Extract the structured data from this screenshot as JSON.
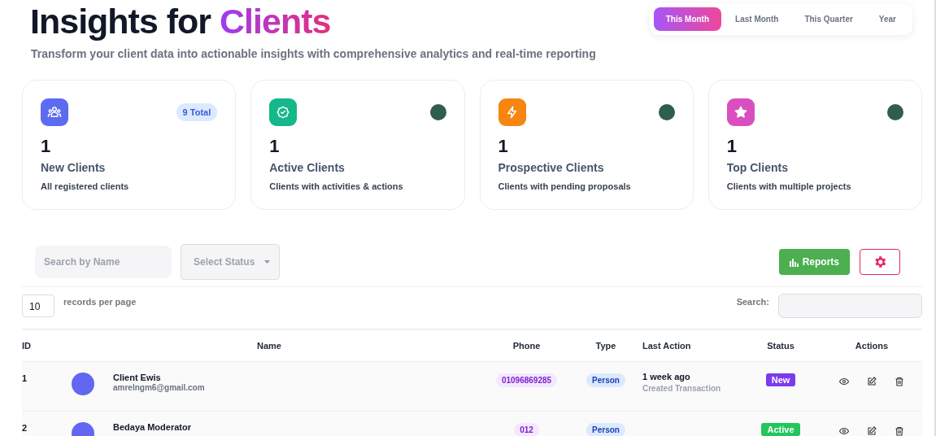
{
  "header": {
    "title": "Insights for",
    "title_accent": "Clients",
    "subtitle": "Transform your client data into actionable insights with comprehensive analytics and real-time reporting"
  },
  "periods": [
    {
      "label": "This Month",
      "selected": true
    },
    {
      "label": "Last Month",
      "selected": false
    },
    {
      "label": "This Quarter",
      "selected": false
    },
    {
      "label": "Year",
      "selected": false
    }
  ],
  "cards": [
    {
      "kind": "people",
      "color": "#5b6cf0",
      "value": "1",
      "title": "New Clients",
      "description": "All registered clients",
      "badge": "9 Total"
    },
    {
      "kind": "check",
      "color": "#14b88a",
      "value": "1",
      "title": "Active Clients",
      "description": "Clients with activities & actions"
    },
    {
      "kind": "bolt",
      "color": "#f7850f",
      "value": "1",
      "title": "Prospective Clients",
      "description": "Clients with pending proposals"
    },
    {
      "kind": "star",
      "color": "#d94fc0",
      "value": "1",
      "title": "Top Clients",
      "description": "Clients with multiple projects"
    }
  ],
  "filters": {
    "name_placeholder": "Search by Name",
    "status_placeholder": "Select Status",
    "reports_button": "Reports"
  },
  "table_controls": {
    "page_size": "10",
    "page_size_label": "records per page",
    "search_label": "Search:"
  },
  "table": {
    "columns": [
      "ID",
      "Name",
      "Phone",
      "Type",
      "Last Action",
      "Status",
      "Actions"
    ],
    "rows": [
      {
        "id": "1",
        "name": "Client Ewis",
        "email": "amrelngm6@gmail.com",
        "phone": "01096869285",
        "type": "Person",
        "last_action": "1 week ago",
        "last_action_detail": "Created Transaction",
        "status": "New",
        "color": "#7c3aed"
      },
      {
        "id": "2",
        "name": "Bedaya Moderator",
        "phone": "012",
        "type": "Person",
        "status": "Active",
        "color": "#22c55e"
      }
    ]
  }
}
